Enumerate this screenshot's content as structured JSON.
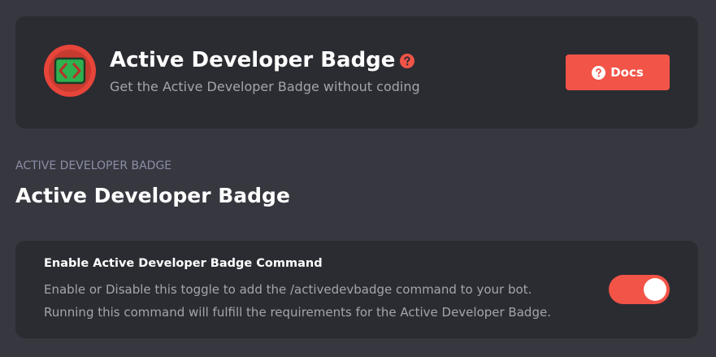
{
  "header": {
    "title": "Active Developer Badge",
    "subtitle": "Get the Active Developer Badge without coding",
    "docs_label": "Docs",
    "icon": "code-badge-icon",
    "help_icon": "question-circle-icon"
  },
  "section": {
    "overline": "ACTIVE DEVELOPER BADGE",
    "title": "Active Developer Badge"
  },
  "setting": {
    "title": "Enable Active Developer Badge Command",
    "description_line1": "Enable or Disable this toggle to add the /activedevbadge command to your bot.",
    "description_line2": "Running this command will fulfill the requirements for the Active Developer Badge.",
    "enabled": true
  },
  "colors": {
    "accent": "#f25447",
    "background": "#36373f",
    "card": "#2b2c32",
    "muted_text": "#a3a5ad",
    "overline_text": "#8c8ea6",
    "badge_green": "#2fb14f"
  }
}
